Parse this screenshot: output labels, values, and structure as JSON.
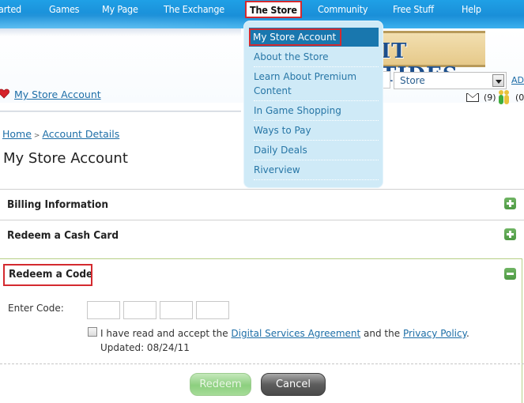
{
  "nav": {
    "items": [
      {
        "label": "arted",
        "active": false
      },
      {
        "label": "Games",
        "active": false
      },
      {
        "label": "My Page",
        "active": false
      },
      {
        "label": "The Exchange",
        "active": false
      },
      {
        "label": "The Store",
        "active": true
      },
      {
        "label": "Community",
        "active": false
      },
      {
        "label": "Free Stuff",
        "active": false
      },
      {
        "label": "Help",
        "active": false
      }
    ]
  },
  "store_menu": {
    "items": [
      {
        "label": "My Store Account",
        "active": true
      },
      {
        "label": "About the Store"
      },
      {
        "label": "Learn About Premium Content"
      },
      {
        "label": "In Game Shopping"
      },
      {
        "label": "Ways to Pay"
      },
      {
        "label": "Daily Deals"
      },
      {
        "label": "Riverview"
      }
    ]
  },
  "header": {
    "logo_text": "IT TIDES",
    "search_scope": "Store",
    "advanced_link": "ADV",
    "mail_count": "(9)",
    "friends_count": "(0",
    "favorite_link": "My Store Account"
  },
  "breadcrumb": {
    "items": [
      "Home",
      "Account Details"
    ],
    "separator": ">"
  },
  "page_title": "My Store Account",
  "sections": [
    {
      "title": "Billing Information",
      "expanded": false,
      "toggle": "+"
    },
    {
      "title": "Redeem a Cash Card",
      "expanded": false,
      "toggle": "+"
    },
    {
      "title": "Redeem a Code",
      "expanded": true,
      "toggle": "-"
    }
  ],
  "redeem_code": {
    "label": "Enter Code:",
    "code_fields": [
      "",
      "",
      "",
      ""
    ],
    "agree_checked": false,
    "agree_prefix": "I have read and accept the ",
    "agreement_link": "Digital Services Agreement",
    "agree_middle": " and the ",
    "privacy_link": "Privacy Policy",
    "agree_suffix": ".",
    "updated": "Updated: 08/24/11",
    "redeem_label": "Redeem",
    "cancel_label": "Cancel"
  },
  "colors": {
    "nav_blue": "#1a8fd8",
    "highlight_red": "#d42a2f",
    "menu_bg": "#cfeaf7",
    "menu_active": "#1977ae",
    "link": "#1d6ea7",
    "toggle_green": "#5ba74f"
  }
}
